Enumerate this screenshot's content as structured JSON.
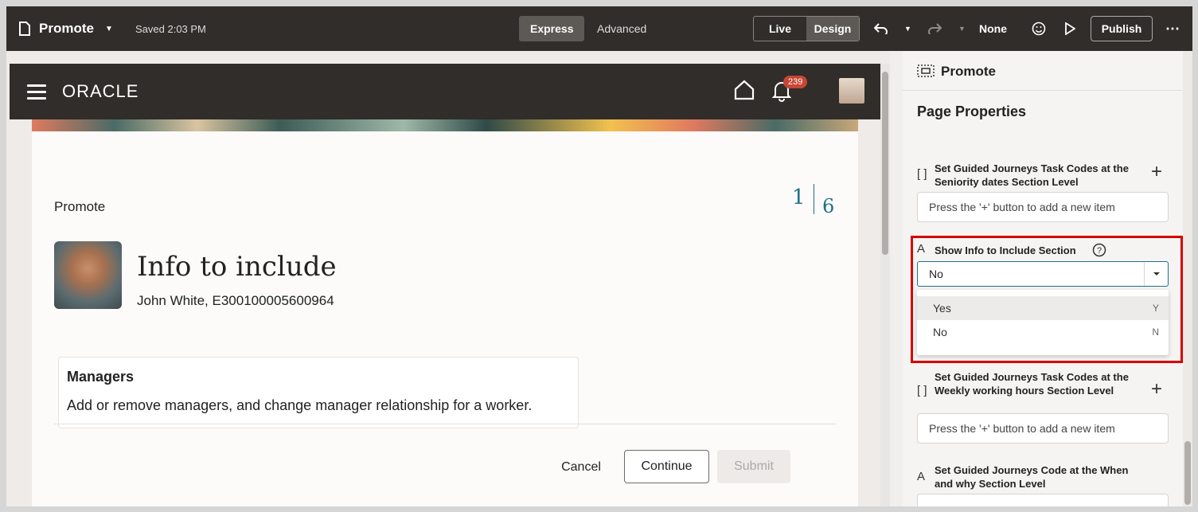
{
  "toolbar": {
    "doc_title": "Promote",
    "saved_text": "Saved 2:03 PM",
    "express_label": "Express",
    "advanced_label": "Advanced",
    "live_label": "Live",
    "design_label": "Design",
    "undo_icon": "undo-icon",
    "redo_icon": "redo-icon",
    "none_label": "None",
    "publish_label": "Publish"
  },
  "app": {
    "logo_text": "ORACLE",
    "notification_count": "239"
  },
  "page": {
    "label": "Promote",
    "step_current": "1",
    "step_total": "6",
    "heading": "Info to include",
    "subheading": "John White, E300100005600964",
    "card_title": "Managers",
    "card_desc": "Add or remove managers, and change manager relationship for a worker.",
    "cancel_label": "Cancel",
    "continue_label": "Continue",
    "submit_label": "Submit"
  },
  "panel": {
    "title": "Promote",
    "section_title": "Page Properties",
    "prop1_label": "Set Guided Journeys Task Codes at the Seniority dates Section Level",
    "prop1_placeholder": "Press the '+' button to add a new item",
    "prop2_label": "Show Info to Include Section",
    "prop2_value": "No",
    "options": [
      {
        "label": "Yes",
        "code": "Y"
      },
      {
        "label": "No",
        "code": "N"
      }
    ],
    "prop3_label": "Set Guided Journeys Task Codes at the Weekly working hours Section Level",
    "prop3_placeholder": "Press the '+' button to add a new item",
    "prop4_label": "Set Guided Journeys Code at the When and why Section Level"
  },
  "colors": {
    "toolbar_bg": "#312d2a",
    "accent": "#1f6f8b",
    "highlight": "#d90000",
    "badge": "#c74634"
  }
}
